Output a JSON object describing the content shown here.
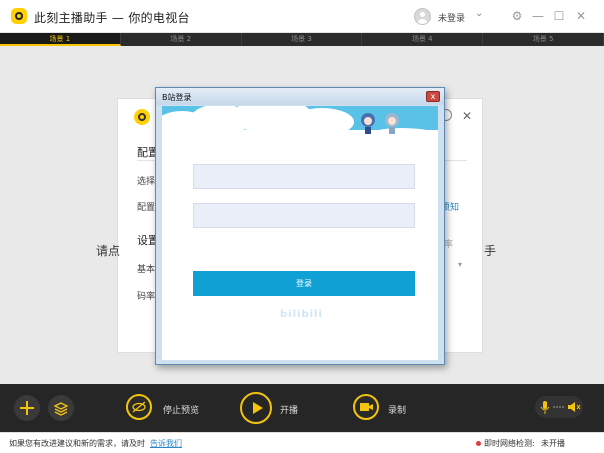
{
  "app": {
    "title": "此刻主播助手 — 你的电视台",
    "user_status": "未登录"
  },
  "scene_tabs": [
    "场景 1",
    "场景 2",
    "场景 3",
    "场景 4",
    "场景 5"
  ],
  "config_dialog": {
    "section_config": "配置",
    "row_select": "选择",
    "row_config": "配置",
    "notice_link": "须知",
    "hint_left": "请点",
    "hint_right": "手",
    "section_settings": "设置",
    "row_basic": "基本",
    "row_bitrate": "码率",
    "rate_label": "率"
  },
  "login_window": {
    "title": "B站登录",
    "close_glyph": "x",
    "username_value": "",
    "password_value": "",
    "login_button": "登录",
    "watermark": "bilibili"
  },
  "toolbar": {
    "stop_preview": "停止预览",
    "start_stream": "开播",
    "record": "录制"
  },
  "statusbar": {
    "feedback_text": "如果您有改进建议和新的需求，请及时",
    "feedback_link": "告诉我们",
    "network_label": "即时网络检测:",
    "network_value": "未开播"
  },
  "colors": {
    "accent": "#f2c40f",
    "bilibili_blue": "#10a0d3",
    "toolbar_bg": "#262626"
  }
}
